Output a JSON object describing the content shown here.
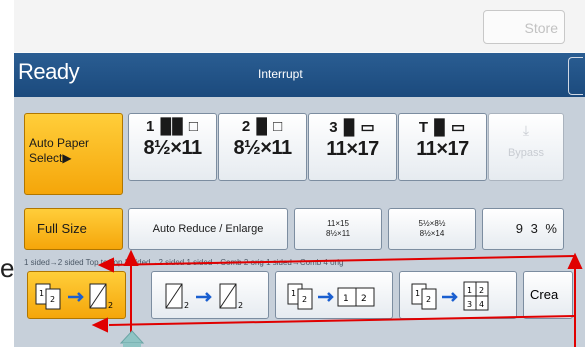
{
  "header": {
    "store_label": "Store"
  },
  "status_bar": {
    "status": "Ready",
    "interrupt": "Interrupt"
  },
  "paper": {
    "auto_paper": "Auto Paper Select▶",
    "trays": [
      {
        "indicator": "1 ██ □",
        "size": "8½×11"
      },
      {
        "indicator": "2 █ □",
        "size": "8½×11"
      },
      {
        "indicator": "3 █ ▭",
        "size": "11×17"
      },
      {
        "indicator": "T █ ▭",
        "size": "11×17"
      }
    ],
    "bypass_label": "Bypass"
  },
  "ratio": {
    "full_size": "Full Size",
    "reduce_enlarge": "Auto Reduce / Enlarge",
    "preset_1": {
      "line1": "11×15",
      "line2": "8½×11"
    },
    "preset_2": {
      "line1": "5½×8½",
      "line2": "8½×14"
    },
    "zoom": "9 3 %"
  },
  "duplex": {
    "caption": "1 sided→2 sided Top to Top    2 sided→2 sided    1 sided→Comb 2 orig    1 sided→Comb 4 orig",
    "create_label": "Crea"
  },
  "edge_letter": "e",
  "colors": {
    "selected": "#f5a60a",
    "status_bar": "#1b4a7d",
    "annotation": "#e00000",
    "pointer": "#8fc4c4"
  }
}
